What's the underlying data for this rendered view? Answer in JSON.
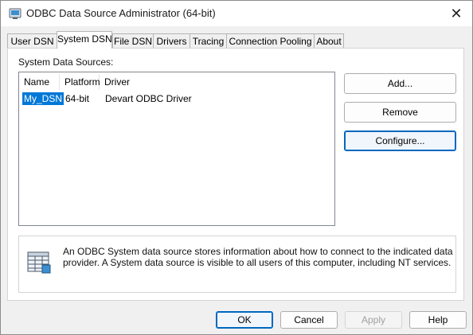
{
  "window": {
    "title": "ODBC Data Source Administrator (64-bit)",
    "close_glyph": "✕"
  },
  "tabs": [
    {
      "label": "User DSN"
    },
    {
      "label": "System DSN",
      "active": true
    },
    {
      "label": "File DSN"
    },
    {
      "label": "Drivers"
    },
    {
      "label": "Tracing"
    },
    {
      "label": "Connection Pooling"
    },
    {
      "label": "About"
    }
  ],
  "panel": {
    "list_label": "System Data Sources:",
    "columns": [
      "Name",
      "Platform",
      "Driver"
    ],
    "rows": [
      {
        "name": "My_DSN",
        "platform": "64-bit",
        "driver": "Devart ODBC Driver",
        "selected": true
      }
    ],
    "buttons": {
      "add": "Add...",
      "remove": "Remove",
      "configure": "Configure..."
    },
    "info_text": "An ODBC System data source stores information about how to connect to the indicated data provider. A System data source is visible to all users of this computer, including NT services."
  },
  "footer": {
    "ok": "OK",
    "cancel": "Cancel",
    "apply": "Apply",
    "help": "Help"
  },
  "colors": {
    "accent": "#0078d7",
    "focus_border": "#0067c0"
  },
  "icons": {
    "app": "odbc-admin-icon",
    "info": "data-source-table-icon",
    "close": "close-icon"
  }
}
